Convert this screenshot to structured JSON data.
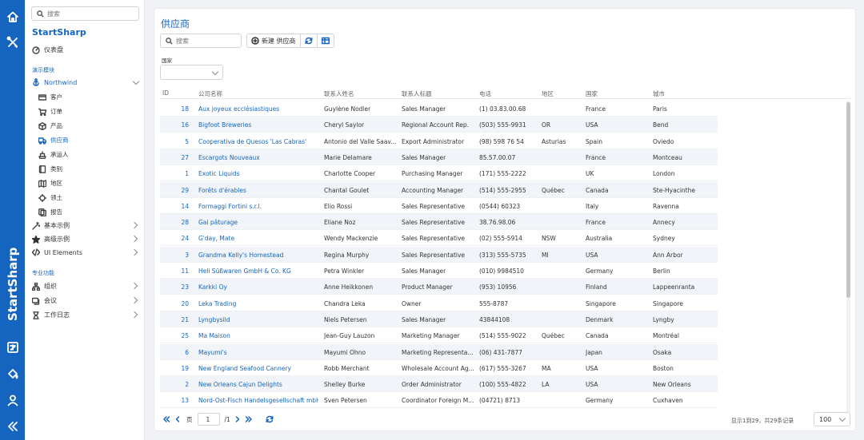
{
  "app": {
    "brand": "StartSharp"
  },
  "rail": {
    "brand_text": "StartSharp",
    "icons": [
      "home-icon",
      "tools-icon",
      "translate-icon",
      "paint-bucket-icon",
      "user-icon",
      "collapse-icon"
    ]
  },
  "sidebar": {
    "search_placeholder": "搜索",
    "brand": "StartSharp",
    "dashboard": "仪表盘",
    "group_demo": "演示模块",
    "northwind": "Northwind",
    "items": [
      {
        "label": "客户",
        "icon": "card-icon"
      },
      {
        "label": "订单",
        "icon": "cart-icon"
      },
      {
        "label": "产品",
        "icon": "box-icon"
      },
      {
        "label": "供应商",
        "icon": "truck-icon"
      },
      {
        "label": "承运人",
        "icon": "ship-icon"
      },
      {
        "label": "类别",
        "icon": "folder-icon"
      },
      {
        "label": "地区",
        "icon": "map-icon"
      },
      {
        "label": "领土",
        "icon": "territory-icon"
      },
      {
        "label": "报告",
        "icon": "report-icon"
      }
    ],
    "basic_samples": "基本示例",
    "advanced_samples": "高级示例",
    "ui_elements": "UI Elements",
    "group_pro": "专业功能",
    "organization": "组织",
    "meeting": "会议",
    "work_log": "工作日志"
  },
  "main": {
    "title": "供应商",
    "search_placeholder": "搜索",
    "new_button": "新建 供应商",
    "filter_label": "国家",
    "columns": [
      "ID",
      "公司名称",
      "联系人姓名",
      "联系人标题",
      "电话",
      "地区",
      "国家",
      "城市"
    ],
    "rows": [
      [
        "18",
        "Aux joyeux ecclésiastiques",
        "Guylène Nodier",
        "Sales Manager",
        "(1) 03.83.00.68",
        "",
        "France",
        "Paris"
      ],
      [
        "16",
        "Bigfoot Breweries",
        "Cheryl Saylor",
        "Regional Account Rep.",
        "(503) 555-9931",
        "OR",
        "USA",
        "Bend"
      ],
      [
        "5",
        "Cooperativa de Quesos 'Las Cabras'",
        "Antonio del Valle Saav...",
        "Export Administrator",
        "(98) 598 76 54",
        "Asturias",
        "Spain",
        "Oviedo"
      ],
      [
        "27",
        "Escargots Nouveaux",
        "Marie Delamare",
        "Sales Manager",
        "85.57.00.07",
        "",
        "France",
        "Montceau"
      ],
      [
        "1",
        "Exotic Liquids",
        "Charlotte Cooper",
        "Purchasing Manager",
        "(171) 555-2222",
        "",
        "UK",
        "London"
      ],
      [
        "29",
        "Forêts d'érables",
        "Chantal Goulet",
        "Accounting Manager",
        "(514) 555-2955",
        "Québec",
        "Canada",
        "Ste-Hyacinthe"
      ],
      [
        "14",
        "Formaggi Fortini s.r.l.",
        "Elio Rossi",
        "Sales Representative",
        "(0544) 60323",
        "",
        "Italy",
        "Ravenna"
      ],
      [
        "28",
        "Gai pâturage",
        "Eliane Noz",
        "Sales Representative",
        "38.76.98.06",
        "",
        "France",
        "Annecy"
      ],
      [
        "24",
        "G'day, Mate",
        "Wendy Mackenzie",
        "Sales Representative",
        "(02) 555-5914",
        "NSW",
        "Australia",
        "Sydney"
      ],
      [
        "3",
        "Grandma Kelly's Homestead",
        "Regina Murphy",
        "Sales Representative",
        "(313) 555-5735",
        "MI",
        "USA",
        "Ann Arbor"
      ],
      [
        "11",
        "Heli Süßwaren GmbH & Co. KG",
        "Petra Winkler",
        "Sales Manager",
        "(010) 9984510",
        "",
        "Germany",
        "Berlin"
      ],
      [
        "23",
        "Karkki Oy",
        "Anne Heikkonen",
        "Product Manager",
        "(953) 10956",
        "",
        "Finland",
        "Lappeenranta"
      ],
      [
        "20",
        "Leka Trading",
        "Chandra Leka",
        "Owner",
        "555-8787",
        "",
        "Singapore",
        "Singapore"
      ],
      [
        "21",
        "Lyngbysild",
        "Niels Petersen",
        "Sales Manager",
        "43844108",
        "",
        "Denmark",
        "Lyngby"
      ],
      [
        "25",
        "Ma Maison",
        "Jean-Guy Lauzon",
        "Marketing Manager",
        "(514) 555-9022",
        "Québec",
        "Canada",
        "Montréal"
      ],
      [
        "6",
        "Mayumi's",
        "Mayumi Ohno",
        "Marketing Representa...",
        "(06) 431-7877",
        "",
        "Japan",
        "Osaka"
      ],
      [
        "19",
        "New England Seafood Cannery",
        "Robb Merchant",
        "Wholesale Account Ag...",
        "(617) 555-3267",
        "MA",
        "USA",
        "Boston"
      ],
      [
        "2",
        "New Orleans Cajun Delights",
        "Shelley Burke",
        "Order Administrator",
        "(100) 555-4822",
        "LA",
        "USA",
        "New Orleans"
      ],
      [
        "13",
        "Nord-Ost-Fisch Handelsgesellschaft mbH",
        "Sven Petersen",
        "Coordinator Foreign M...",
        "(04721) 8713",
        "",
        "Germany",
        "Cuxhaven"
      ]
    ],
    "pager": {
      "page_label": "页",
      "page_value": "1",
      "of_pages": "/1",
      "info": "显示1到29，共29条记录",
      "page_size": "100"
    }
  }
}
